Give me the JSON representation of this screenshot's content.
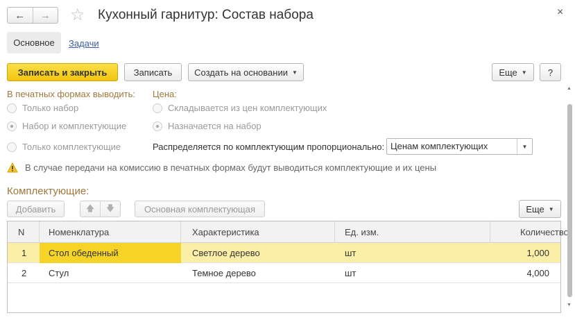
{
  "window": {
    "title": "Кухонный гарнитур: Состав набора",
    "back_icon": "←",
    "forward_icon": "→",
    "star_icon": "☆",
    "close_icon": "×"
  },
  "tabs": {
    "main": "Основное",
    "tasks": "Задачи"
  },
  "toolbar": {
    "save_close": "Записать и закрыть",
    "save": "Записать",
    "create_based": "Создать на основании",
    "more": "Еще",
    "help": "?"
  },
  "print_forms": {
    "label": "В печатных формах выводить:",
    "options": [
      "Только набор",
      "Набор и комплектующие",
      "Только комплектующие"
    ],
    "selected_index": 1
  },
  "price": {
    "label": "Цена:",
    "options": [
      "Складывается из цен комплектующих",
      "Назначается на набор"
    ],
    "selected_index": 1
  },
  "distribution": {
    "label": "Распределяется по комплектующим пропорционально:",
    "value": "Ценам комплектующих"
  },
  "warning": {
    "icon": "warning-triangle",
    "text": "В случае передачи на комиссию в печатных формах будут выводиться комплектующие и их цены"
  },
  "components": {
    "title": "Комплектующие:",
    "add_button": "Добавить",
    "main_component_button": "Основная комплектующая",
    "more_button": "Еще",
    "columns": [
      "N",
      "Номенклатура",
      "Характеристика",
      "Ед. изм.",
      "Количество"
    ],
    "rows": [
      {
        "n": "1",
        "item": "Стол обеденный",
        "characteristic": "Светлое дерево",
        "unit": "шт",
        "qty": "1,000"
      },
      {
        "n": "2",
        "item": "Стул",
        "characteristic": "Темное дерево",
        "unit": "шт",
        "qty": "4,000"
      }
    ]
  },
  "colors": {
    "accent_yellow": "#f1c40f",
    "selected_row": "#fbeea6",
    "group_label": "#a0783c",
    "link": "#3a5e9c"
  }
}
